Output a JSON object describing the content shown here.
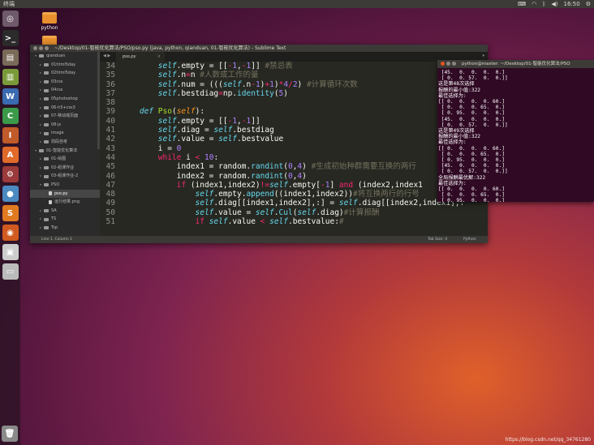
{
  "top_panel": {
    "app_title": "终端",
    "clock": "16:50",
    "tray_icons": [
      "keyboard-icon",
      "wifi-icon",
      "bluetooth-icon",
      "volume-icon",
      "gear-icon"
    ]
  },
  "launcher": {
    "items": [
      {
        "name": "dash-icon",
        "glyph": "◎",
        "color": "#6e5a6a"
      },
      {
        "name": "terminal-icon",
        "glyph": ">_",
        "color": "#2b2b2b"
      },
      {
        "name": "files-icon",
        "glyph": "▤",
        "color": "#7a6a5a"
      },
      {
        "name": "book-icon",
        "glyph": "▥",
        "color": "#7a9a3a"
      },
      {
        "name": "writer-icon",
        "glyph": "W",
        "color": "#3a6ab0"
      },
      {
        "name": "calc-icon",
        "glyph": "C",
        "color": "#3a9a4a"
      },
      {
        "name": "impress-icon",
        "glyph": "I",
        "color": "#c05a2a"
      },
      {
        "name": "software-icon",
        "glyph": "A",
        "color": "#e06a2a"
      },
      {
        "name": "settings-icon",
        "glyph": "⚙",
        "color": "#9a3a3a"
      },
      {
        "name": "chrome-icon",
        "glyph": "●",
        "color": "#4a8ac0"
      },
      {
        "name": "sublime-icon",
        "glyph": "S",
        "color": "#e07a20"
      },
      {
        "name": "firefox-icon",
        "glyph": "◉",
        "color": "#d05a20"
      },
      {
        "name": "floppy-icon",
        "glyph": "▣",
        "color": "#cccccc"
      },
      {
        "name": "drive-icon",
        "glyph": "▭",
        "color": "#bbbbbb"
      }
    ]
  },
  "desktop": {
    "icons": [
      {
        "label": "python"
      },
      {
        "label": ""
      }
    ]
  },
  "sublime": {
    "title": "~/Desktop/01-智能优化算法/PSO/pso.py (java, python, qianduan, 01-智能优化算法) - Sublime Text",
    "tab_name": "pso.py",
    "tab_close": "×",
    "sidebar": [
      {
        "label": "qianduan",
        "indent": 0,
        "arrow": "▾",
        "type": "folder",
        "selected": false
      },
      {
        "label": "01html5day",
        "indent": 1,
        "arrow": "▸",
        "type": "folder",
        "selected": false
      },
      {
        "label": "02html5day",
        "indent": 1,
        "arrow": "▸",
        "type": "folder",
        "selected": false
      },
      {
        "label": "03css",
        "indent": 1,
        "arrow": "▸",
        "type": "folder",
        "selected": false
      },
      {
        "label": "04css",
        "indent": 1,
        "arrow": "▸",
        "type": "folder",
        "selected": false
      },
      {
        "label": "05photoshop",
        "indent": 1,
        "arrow": "▸",
        "type": "folder",
        "selected": false
      },
      {
        "label": "06-h5+css3",
        "indent": 1,
        "arrow": "▸",
        "type": "folder",
        "selected": false
      },
      {
        "label": "07-移动端页面",
        "indent": 1,
        "arrow": "▸",
        "type": "folder",
        "selected": false
      },
      {
        "label": "08-js",
        "indent": 1,
        "arrow": "▸",
        "type": "folder",
        "selected": false
      },
      {
        "label": "image",
        "indent": 1,
        "arrow": "▸",
        "type": "folder",
        "selected": false
      },
      {
        "label": "前段自考",
        "indent": 1,
        "arrow": "▸",
        "type": "folder",
        "selected": false
      },
      {
        "label": "01-智能优化算法",
        "indent": 0,
        "arrow": "▾",
        "type": "folder",
        "selected": false
      },
      {
        "label": "01-绘图",
        "indent": 1,
        "arrow": "▸",
        "type": "folder",
        "selected": false
      },
      {
        "label": "02-组课作业",
        "indent": 1,
        "arrow": "▸",
        "type": "folder",
        "selected": false
      },
      {
        "label": "03-组课作业-2",
        "indent": 1,
        "arrow": "▸",
        "type": "folder",
        "selected": false
      },
      {
        "label": "PSO",
        "indent": 1,
        "arrow": "▾",
        "type": "folder",
        "selected": false
      },
      {
        "label": "pso.py",
        "indent": 2,
        "arrow": "",
        "type": "file",
        "selected": true
      },
      {
        "label": "运行结果.png",
        "indent": 2,
        "arrow": "",
        "type": "file",
        "selected": false
      },
      {
        "label": "SA",
        "indent": 1,
        "arrow": "▸",
        "type": "folder",
        "selected": false
      },
      {
        "label": "TS",
        "indent": 1,
        "arrow": "▸",
        "type": "folder",
        "selected": false
      },
      {
        "label": "Tsp",
        "indent": 1,
        "arrow": "▸",
        "type": "folder",
        "selected": false
      }
    ],
    "code_lines": [
      {
        "no": "34",
        "html": "        <span class='d'>self</span>.empty = [[<span class='k'>-</span><span class='n'>1</span>,<span class='k'>-</span><span class='n'>1</span>]] <span class='c'>#禁忌表</span>"
      },
      {
        "no": "35",
        "html": "        <span class='d'>self</span>.n<span class='k'>=</span>n <span class='c'>#人数或工作的量</span>"
      },
      {
        "no": "36",
        "html": "        <span class='d'>self</span>.num = (((<span class='d'>self</span>.n<span class='k'>-</span><span class='n'>1</span>)<span class='k'>+</span><span class='n'>1</span>)<span class='k'>*</span><span class='n'>4</span><span class='k'>/</span><span class='n'>2</span>) <span class='c'>#计算循环次数</span>"
      },
      {
        "no": "37",
        "html": "        <span class='d'>self</span>.bestdiag<span class='k'>=</span>np.<span class='f'>identity</span>(<span class='n'>5</span>)"
      },
      {
        "no": "38",
        "html": ""
      },
      {
        "no": "39",
        "html": "    <span class='d'>def</span> <span class='fn'>Pso</span>(<span class='s'>self</span>):"
      },
      {
        "no": "40",
        "html": "        <span class='d'>self</span>.empty = [[<span class='k'>-</span><span class='n'>1</span>,<span class='k'>-</span><span class='n'>1</span>]]"
      },
      {
        "no": "41",
        "html": "        <span class='d'>self</span>.diag = <span class='d'>self</span>.bestdiag"
      },
      {
        "no": "42",
        "html": "        <span class='d'>self</span>.value = <span class='d'>self</span>.bestvalue"
      },
      {
        "no": "43",
        "html": "        i = <span class='n'>0</span>"
      },
      {
        "no": "44",
        "html": "        <span class='k'>while</span> i <span class='k'>&lt;</span> <span class='n'>10</span>:"
      },
      {
        "no": "45",
        "html": "            index1 = random.<span class='f'>randint</span>(<span class='n'>0</span>,<span class='n'>4</span>) <span class='c'>#生成初始种群需要互换的两行</span>"
      },
      {
        "no": "46",
        "html": "            index2 = random.<span class='f'>randint</span>(<span class='n'>0</span>,<span class='n'>4</span>)"
      },
      {
        "no": "47",
        "html": "            <span class='k'>if</span> (index1,index2)<span class='k'>!=</span><span class='d'>self</span>.empty[<span class='k'>-</span><span class='n'>1</span>] <span class='k'>and</span> (index2,index1"
      },
      {
        "no": "48",
        "html": "                <span class='d'>self</span>.empty.<span class='f'>append</span>((index1,index2))<span class='c'>#将互换两行的行号</span>"
      },
      {
        "no": "49",
        "html": "                <span class='d'>self</span>.diag[[index1,index2],:] = <span class='d'>self</span>.diag[[index2,index1],:"
      },
      {
        "no": "50",
        "html": "                <span class='d'>self</span>.value = <span class='d'>self</span>.<span class='f'>Cul</span>(<span class='d'>self</span>.diag)<span class='c'>#计算报酬</span>"
      },
      {
        "no": "51",
        "html": "                <span class='k'>if</span> <span class='d'>self</span>.value <span class='k'>&lt;</span> <span class='d'>self</span>.bestvalue:<span class='c'>#</span>"
      }
    ],
    "status": {
      "position": "Line 1, Column 1",
      "tab_size": "Tab Size: 4",
      "syntax": "Python"
    }
  },
  "terminal": {
    "title": "python@master: ~/Desktop/01-智能优化算法/PSO",
    "lines": [
      " [45.  0.  0.  0.  0.]",
      " [ 0.  0. 57.  0.  0.]]",
      "这是第48次选择",
      "报酬的最小值:322",
      "最佳选择为:",
      "[[ 0.  0.  0.  0. 60.]",
      " [ 0.  0.  0. 65.  0.]",
      " [ 0. 95.  0.  0.  0.]",
      " [45.  0.  0.  0.  0.]",
      " [ 0.  0. 57.  0.  0.]]",
      "这是第49次选择",
      "报酬的最小值:322",
      "最佳选择为:",
      "[[ 0.  0.  0.  0. 60.]",
      " [ 0.  0.  0. 65.  0.]",
      " [ 0. 95.  0.  0.  0.]",
      " [45.  0.  0.  0.  0.]",
      " [ 0.  0. 57.  0.  0.]]",
      "全局报酬最优解:322",
      "最佳选择为:",
      "[[ 0.  0.  0.  0. 60.]",
      " [ 0.  0.  0. 65.  0.]",
      " [ 0. 95.  0.  0.  0.]",
      " [45.  0.  0.  0.  0.]"
    ]
  },
  "watermark": "https://blog.csdn.net/qq_34761280"
}
